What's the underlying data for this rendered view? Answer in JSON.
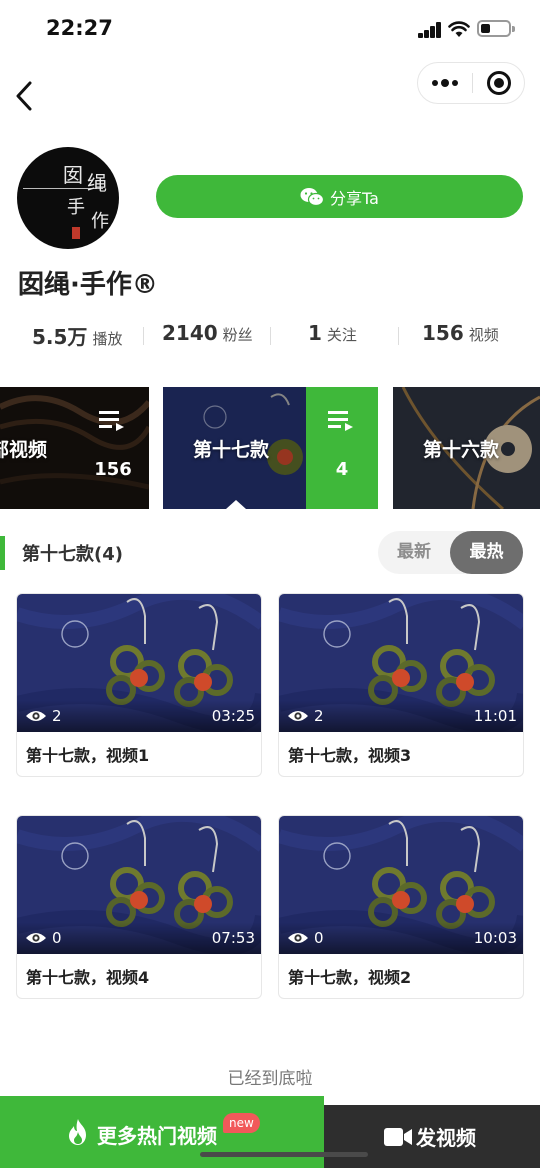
{
  "status_bar": {
    "time": "22:27"
  },
  "profile": {
    "name": "囡绳·手作®",
    "avatar_text": [
      "囡",
      "绳",
      "手",
      "作"
    ],
    "share_label": "分享Ta",
    "stats": [
      {
        "value": "5.5万",
        "label": "播放"
      },
      {
        "value": "2140",
        "label": "粉丝"
      },
      {
        "value": "1",
        "label": "关注"
      },
      {
        "value": "156",
        "label": "视频"
      }
    ]
  },
  "playlists": [
    {
      "title": "部视频",
      "count": "156"
    },
    {
      "title": "第十七款",
      "count": "4"
    },
    {
      "title": "第十六款"
    }
  ],
  "section": {
    "title": "第十七款(4)",
    "sort_latest": "最新",
    "sort_hot": "最热",
    "selected_sort": "最热"
  },
  "videos": [
    {
      "title": "第十七款，视频1",
      "views": "2",
      "duration": "03:25"
    },
    {
      "title": "第十七款，视频3",
      "views": "2",
      "duration": "11:01"
    },
    {
      "title": "第十七款，视频4",
      "views": "0",
      "duration": "07:53"
    },
    {
      "title": "第十七款，视频2",
      "views": "0",
      "duration": "10:03"
    }
  ],
  "end_text": "已经到底啦",
  "bottom_bar": {
    "more_hot_label": "更多热门视频",
    "new_badge": "new",
    "post_label": "发视频"
  },
  "colors": {
    "accent": "#3fb83a",
    "dark_bar": "#2e2e2e",
    "badge": "#f1595a",
    "sort_active": "#6e6e6e"
  }
}
